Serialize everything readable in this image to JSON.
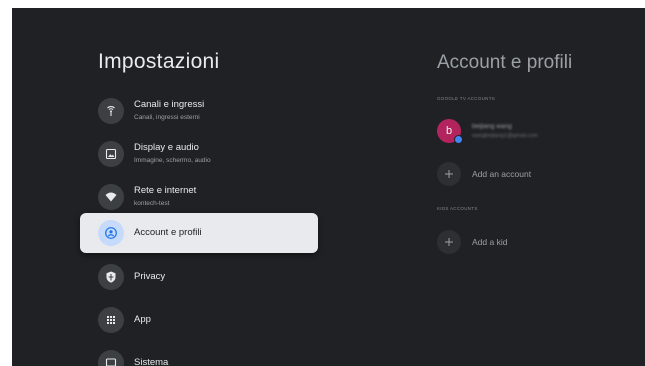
{
  "settings": {
    "title": "Impostazioni",
    "items": [
      {
        "label": "Canali e ingressi",
        "sub": "Canali, ingressi esterni",
        "icon": "antenna-icon"
      },
      {
        "label": "Display e audio",
        "sub": "Immagine, schermo, audio",
        "icon": "display-icon"
      },
      {
        "label": "Rete e internet",
        "sub": "kontech-test",
        "icon": "wifi-icon"
      },
      {
        "label": "Account e profili",
        "sub": "",
        "icon": "account-icon",
        "selected": true
      },
      {
        "label": "Privacy",
        "sub": "",
        "icon": "shield-icon"
      },
      {
        "label": "App",
        "sub": "",
        "icon": "apps-grid-icon"
      },
      {
        "label": "Sistema",
        "sub": "",
        "icon": "system-icon"
      }
    ]
  },
  "panel": {
    "title": "Account e profili",
    "google_section": "GOOGLE TV ACCOUNTS",
    "account": {
      "initial": "b",
      "name": "beijiang wang",
      "email": "wangbeijiang1@gmail.com"
    },
    "add_account": "Add an account",
    "kids_section": "KIDS ACCOUNTS",
    "add_kid": "Add a kid"
  },
  "colors": {
    "background": "#202124",
    "selected": "#e8eaed",
    "avatar": "#b3245e",
    "accent": "#4285f4"
  }
}
